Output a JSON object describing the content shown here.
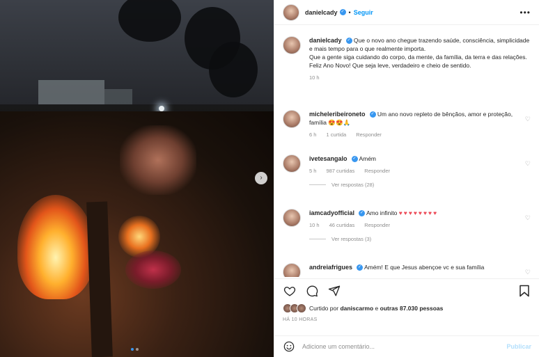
{
  "header": {
    "username": "danielcady",
    "follow_label": "Seguir",
    "more_label": "•••"
  },
  "caption": {
    "username": "danielcady",
    "lines": [
      "Que o novo ano chegue trazendo saúde, consciência, simplicidade e mais tempo para o que realmente importa.",
      "Que a gente siga cuidando do corpo, da mente, da família, da terra e das relações.",
      "Feliz Ano Novo! Que seja leve, verdadeiro e cheio de sentido."
    ],
    "time": "10 h"
  },
  "comments": [
    {
      "username": "micheleribeironeto",
      "text": "Um ano novo repleto de bênçãos, amor e proteção, família",
      "emoji": "😍😍🙏",
      "time": "6 h",
      "likes": "1 curtida",
      "reply_label": "Responder"
    },
    {
      "username": "ivetesangalo",
      "text": "Amém",
      "time": "5 h",
      "likes": "987 curtidas",
      "reply_label": "Responder",
      "view_replies": "Ver respostas (28)"
    },
    {
      "username": "iamcadyofficial",
      "text": "Amo infinito",
      "hearts": "♥♥♥♥♥♥♥♥",
      "time": "10 h",
      "likes": "46 curtidas",
      "reply_label": "Responder",
      "view_replies": "Ver respostas (3)"
    },
    {
      "username": "andreiafrigues",
      "text": "Amém! E que Jesus abençoe vc e sua família"
    }
  ],
  "likes": {
    "liked_by_prefix": "Curtido por",
    "liked_by_user": "daniscarmo",
    "liked_by_suffix": "e",
    "others": "outras 87.030 pessoas"
  },
  "timestamp": "HÁ 10 HORAS",
  "composer": {
    "placeholder": "Adicione um comentário...",
    "post_label": "Publicar"
  },
  "colors": {
    "accent": "#0095f6",
    "verified": "#3897f0",
    "heart_red": "#ed4956",
    "muted": "#8e8e8e"
  }
}
